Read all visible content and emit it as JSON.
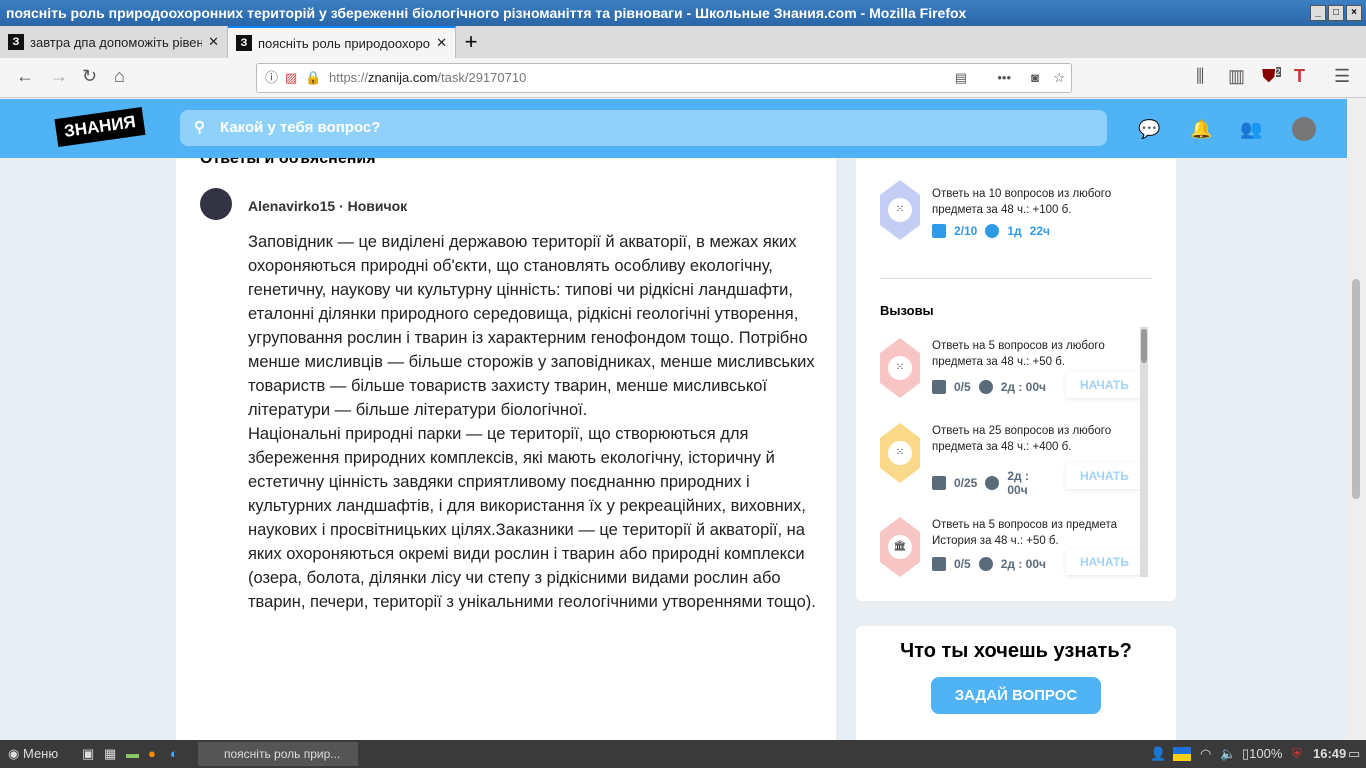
{
  "window": {
    "title": "поясніть роль природоохоронних територій у збереженні біологічного різноманіття та рівноваги - Школьные Знания.com - Mozilla Firefox"
  },
  "tabs": [
    {
      "label": "завтра дпа допоможіть рівен"
    },
    {
      "label": "поясніть роль природоохоро"
    }
  ],
  "favicon": "З",
  "url": {
    "prefix": "https://",
    "domain": "znanija.com",
    "path": "/task/29170710"
  },
  "ublock_count": "2",
  "site": {
    "logo": "ЗНАНИЯ",
    "search_placeholder": "Какой у тебя вопрос?"
  },
  "main": {
    "heading": "Ответы и объяснения",
    "username": "Alenavirko15",
    "rank": "· Новичок",
    "paragraphs": [
      "Заповідник — це виділені державою території й акваторії, в межах яких охороняються природні об'єкти, що становлять особливу екологічну, генетичну, наукову чи культурну цінність: типові чи рідкісні ландшафти, еталонні ділянки природного середовища, рідкісні геологічні утворення, угруповання рослин і тварин із характерним генофондом тощо. Потрібно менше мисливців — більше сторожів у заповідниках, менше мисливських товариств — більше товариств захисту тварин, менше мисливської літератури — більше літератури біологічної.",
      "Національні природні парки — це території, що створюються для збереження природних комплексів, які мають екологічну, історичну й естетичну цінність завдяки сприятливому поєднанню природних і культурних ландшафтів, і для використання їх у рекреаційних, виховних, наукових і просвітницьких цілях.Заказники — це території й акваторії, на яких охороняються окремі види рослин і тварин або природні комплекси (озера, болота, ділянки лісу чи степу з рідкісними видами рослин або тварин, печери, території з унікальними геологічними утвореннями тощо)."
    ]
  },
  "sidebar": {
    "active": {
      "text": "Ответь на 10 вопросов из любого предмета за 48 ч.: +100 б.",
      "progress": "2/10",
      "time_d": "1д",
      "time_h": "22ч"
    },
    "challenges_title": "Вызовы",
    "challenges": [
      {
        "text": "Ответь на 5 вопросов из любого предмета за 48 ч.: +50 б.",
        "progress": "0/5",
        "time": "2д : 00ч",
        "button": "НАЧАТЬ",
        "color": "#f7c6c4"
      },
      {
        "text": "Ответь на 25 вопросов из любого предмета за 48 ч.: +400 б.",
        "progress": "0/25",
        "time": "2д : 00ч",
        "button": "НАЧАТЬ",
        "color": "#fbd98a"
      },
      {
        "text": "Ответь на 5 вопросов из предмета История за 48 ч.: +50 б.",
        "progress": "0/5",
        "time": "2д : 00ч",
        "button": "НАЧАТЬ",
        "color": "#f7c6c4"
      }
    ],
    "ask_title": "Что ты хочешь узнать?",
    "ask_button": "ЗАДАЙ ВОПРОС"
  },
  "taskbar": {
    "menu": "Меню",
    "window": "поясніть роль прир...",
    "battery": "100%",
    "time": "16:49"
  }
}
